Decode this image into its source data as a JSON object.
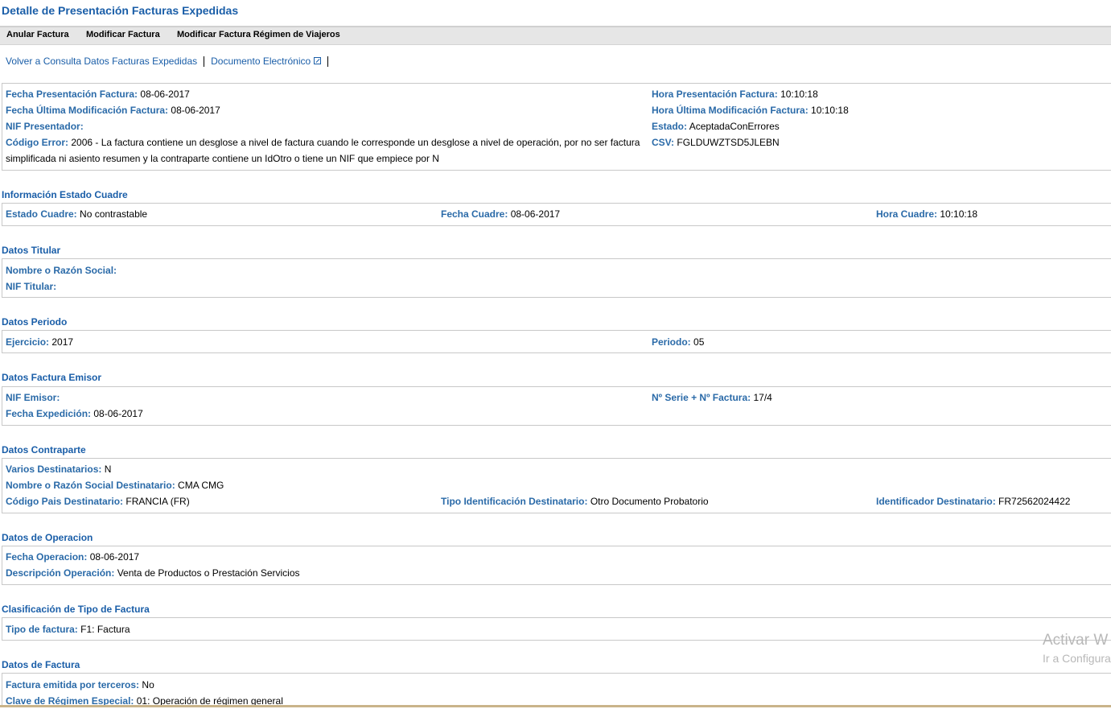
{
  "page": {
    "title": "Detalle de Presentación Facturas Expedidas"
  },
  "toolbar": {
    "anular": "Anular Factura",
    "modificar": "Modificar Factura",
    "modificar_viajeros": "Modificar Factura Régimen de Viajeros"
  },
  "links": {
    "volver": "Volver a Consulta Datos Facturas Expedidas",
    "documento": "Documento Electrónico"
  },
  "presentacion": {
    "fecha_label": "Fecha Presentación Factura:",
    "fecha": "08-06-2017",
    "hora_label": "Hora Presentación Factura:",
    "hora": "10:10:18",
    "fecha_mod_label": "Fecha Última Modificación Factura:",
    "fecha_mod": "08-06-2017",
    "hora_mod_label": "Hora Última Modificación Factura:",
    "hora_mod": "10:10:18",
    "nif_label": "NIF Presentador:",
    "nif": "",
    "estado_label": "Estado:",
    "estado": "AceptadaConErrores",
    "codigo_label": "Código Error:",
    "codigo": "2006 - La factura contiene un desglose a nivel de factura cuando le corresponde un desglose a nivel de operación, por no ser factura simplificada ni asiento resumen y la contraparte contiene un IdOtro o tiene un NIF que empiece por N",
    "csv_label": "CSV:",
    "csv": "FGLDUWZTSD5JLEBN"
  },
  "cuadre": {
    "title": "Información Estado Cuadre",
    "estado_label": "Estado Cuadre:",
    "estado": "No contrastable",
    "fecha_label": "Fecha Cuadre:",
    "fecha": "08-06-2017",
    "hora_label": "Hora Cuadre:",
    "hora": "10:10:18"
  },
  "titular": {
    "title": "Datos Titular",
    "nombre_label": "Nombre o Razón Social:",
    "nombre": "",
    "nif_label": "NIF Titular:",
    "nif": ""
  },
  "periodo": {
    "title": "Datos Periodo",
    "ejercicio_label": "Ejercicio:",
    "ejercicio": "2017",
    "periodo_label": "Periodo:",
    "periodo": "05"
  },
  "emisor": {
    "title": "Datos Factura Emisor",
    "nif_label": "NIF Emisor:",
    "nif": "",
    "serie_label": "Nº Serie + Nº Factura:",
    "serie": "17/4",
    "fecha_label": "Fecha Expedición:",
    "fecha": "08-06-2017"
  },
  "contraparte": {
    "title": "Datos Contraparte",
    "varios_label": "Varios Destinatarios:",
    "varios": "N",
    "nombre_label": "Nombre o Razón Social Destinatario:",
    "nombre": "CMA CMG",
    "pais_label": "Código Pais Destinatario:",
    "pais": "FRANCIA (FR)",
    "tipo_label": "Tipo Identificación Destinatario:",
    "tipo": "Otro Documento Probatorio",
    "id_label": "Identificador Destinatario:",
    "id": "FR72562024422"
  },
  "operacion": {
    "title": "Datos de Operacion",
    "fecha_label": "Fecha Operacion:",
    "fecha": "08-06-2017",
    "desc_label": "Descripción Operación:",
    "desc": "Venta de Productos o Prestación Servicios"
  },
  "clasificacion": {
    "title": "Clasificación de Tipo de Factura",
    "tipo_label": "Tipo de factura:",
    "tipo": "F1: Factura"
  },
  "factura": {
    "title": "Datos de Factura",
    "terceros_label": "Factura emitida por terceros:",
    "terceros": "No",
    "clave_label": "Clave de Régimen Especial:",
    "clave": "01: Operación de régimen general"
  },
  "watermark": {
    "line1": "Activar W",
    "line2": "Ir a Configura"
  }
}
